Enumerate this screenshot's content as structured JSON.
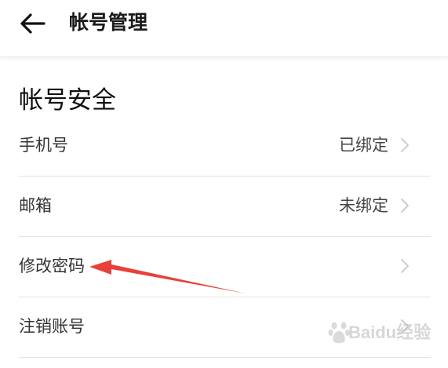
{
  "header": {
    "back_icon": "arrow-left-icon",
    "title": "帐号管理"
  },
  "section": {
    "title": "帐号安全"
  },
  "rows": [
    {
      "label": "手机号",
      "value": "已绑定",
      "icon": "chevron-right-icon"
    },
    {
      "label": "邮箱",
      "value": "未绑定",
      "icon": "chevron-right-icon"
    },
    {
      "label": "修改密码",
      "value": "",
      "icon": "chevron-right-icon"
    },
    {
      "label": "注销账号",
      "value": "",
      "icon": "chevron-right-icon"
    }
  ],
  "annotation": {
    "type": "red-arrow",
    "color": "#e8403a",
    "target": "修改密码"
  },
  "watermark": {
    "text": "Baidu经验"
  },
  "colors": {
    "background": "#ffffff",
    "divider": "#e4e4e4",
    "chevron": "#c8c8c8",
    "arrow": "#e8403a"
  }
}
